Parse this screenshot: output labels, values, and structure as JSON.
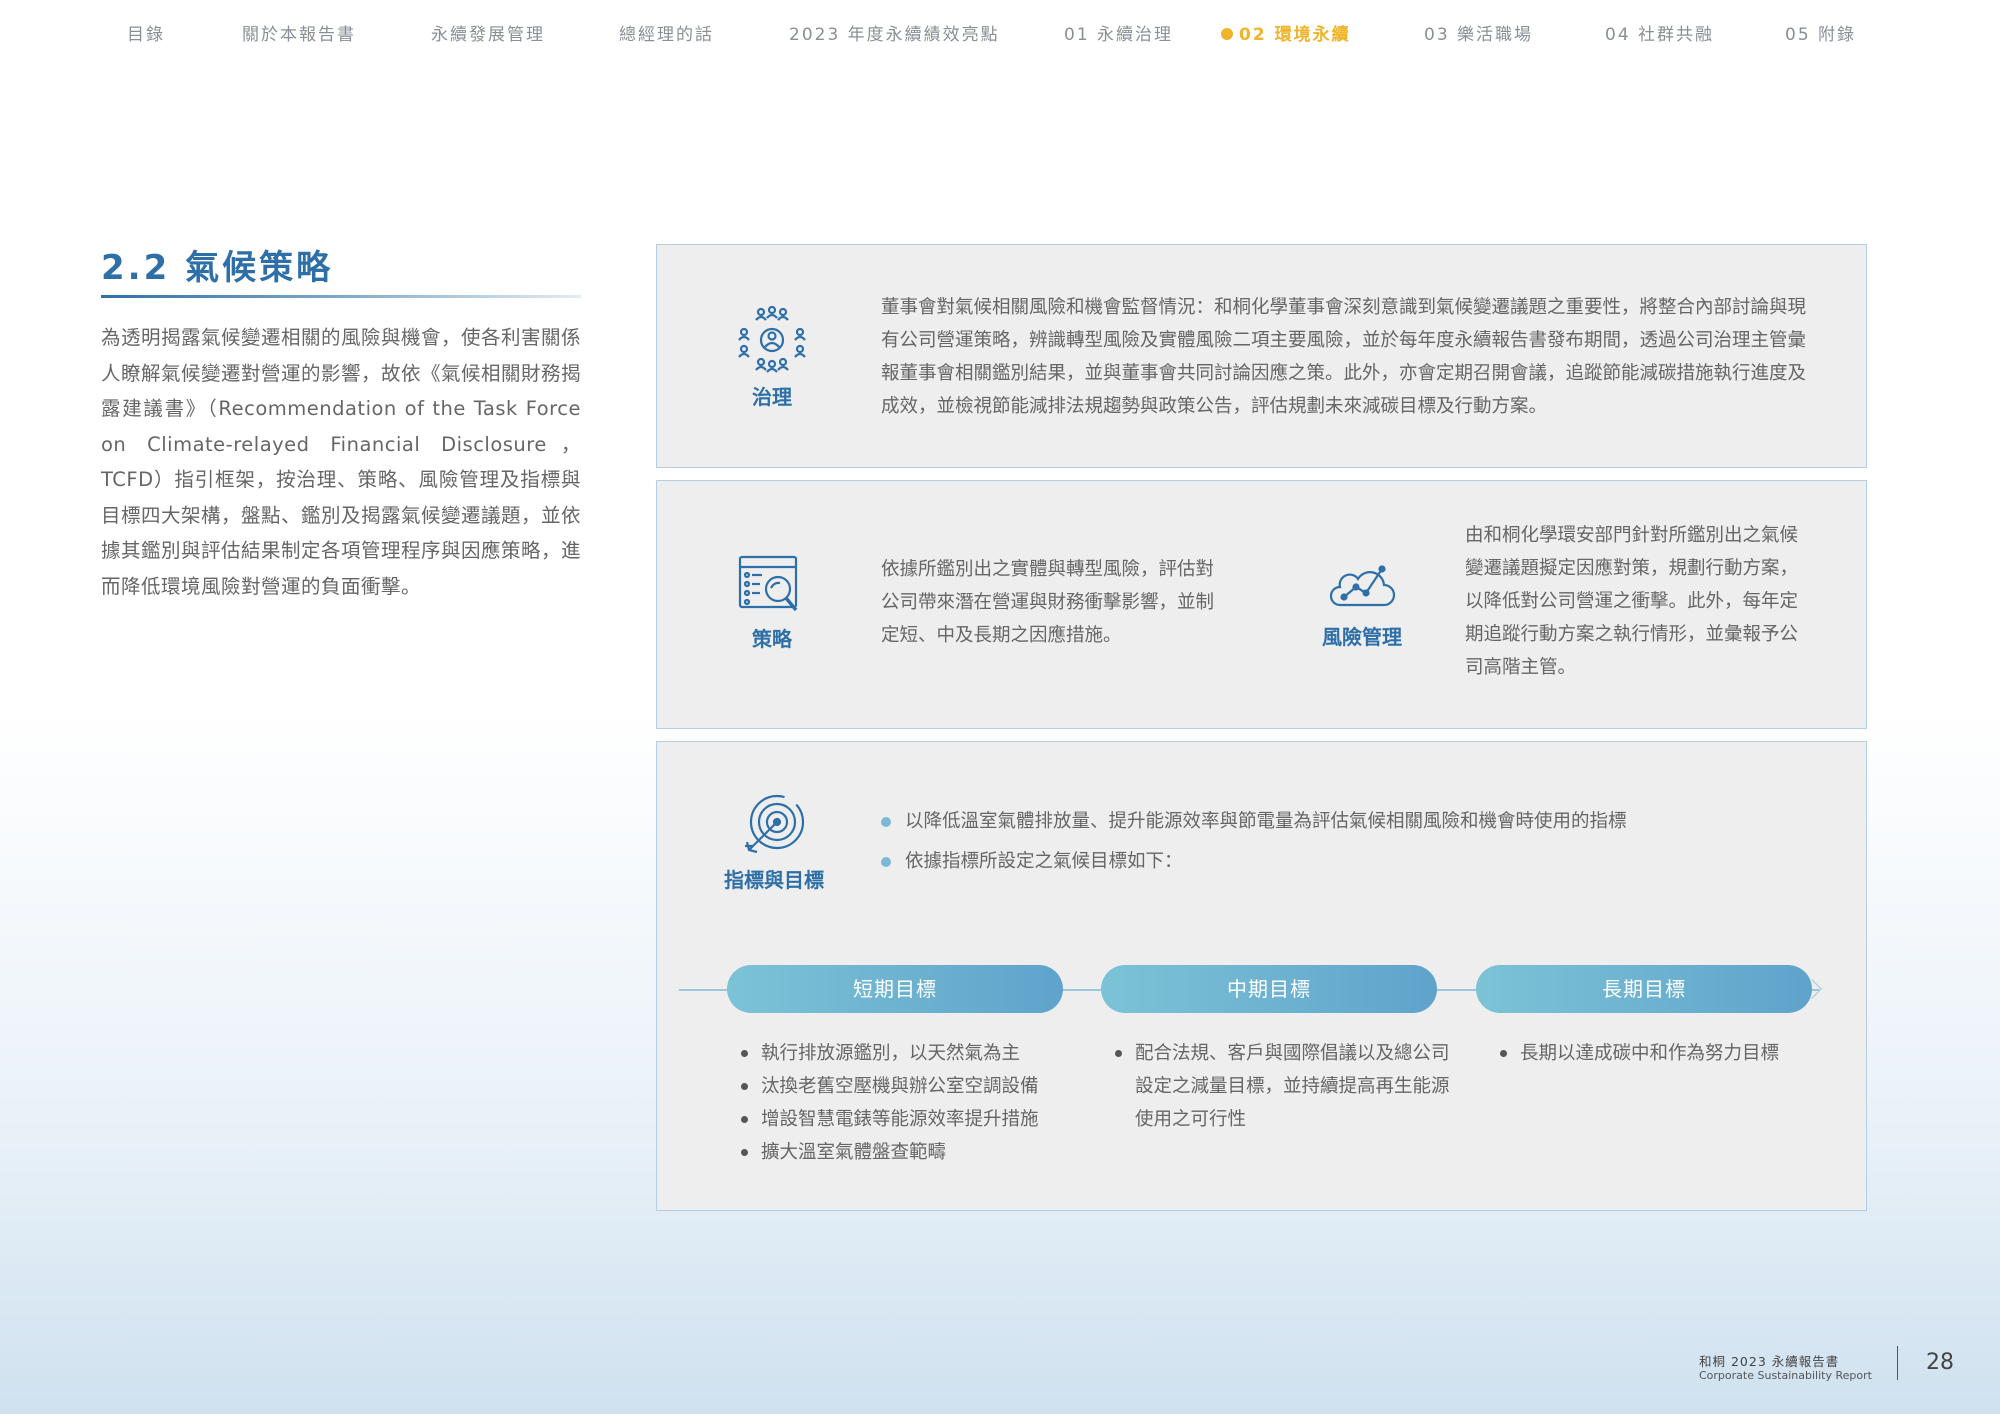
{
  "nav": {
    "items": [
      "目錄",
      "關於本報告書",
      "永續發展管理",
      "總經理的話",
      "2023 年度永續績效亮點",
      "01 永續治理",
      "02 環境永續",
      "03 樂活職場",
      "04 社群共融",
      "05 附錄"
    ],
    "active_index": 6
  },
  "section": {
    "title": "2.2 氣候策略",
    "intro": "為透明揭露氣候變遷相關的風險與機會，使各利害關係人瞭解氣候變遷對營運的影響，故依《氣候相關財務揭露建議書》（Recommendation of the Task Force on Climate-relayed Financial Disclosure，TCFD）指引框架，按治理、策略、風險管理及指標與目標四大架構，盤點、鑑別及揭露氣候變遷議題，並依據其鑑別與評估結果制定各項管理程序與因應策略，進而降低環境風險對營運的負面衝擊。"
  },
  "governance": {
    "label": "治理",
    "icon": "people-network-icon",
    "text": "董事會對氣候相關風險和機會監督情況：和桐化學董事會深刻意識到氣候變遷議題之重要性，將整合內部討論與現有公司營運策略，辨識轉型風險及實體風險二項主要風險，並於每年度永續報告書發布期間，透過公司治理主管彙報董事會相關鑑別結果，並與董事會共同討論因應之策。此外，亦會定期召開會議，追蹤節能減碳措施執行進度及成效，並檢視節能減排法規趨勢與政策公告，評估規劃未來減碳目標及行動方案。"
  },
  "strategy": {
    "label": "策略",
    "icon": "document-magnifier-icon",
    "text": "依據所鑑別出之實體與轉型風險，評估對公司帶來潛在營運與財務衝擊影響，並制定短、中及長期之因應措施。"
  },
  "risk": {
    "label": "風險管理",
    "icon": "cloud-chart-icon",
    "text": "由和桐化學環安部門針對所鑑別出之氣候變遷議題擬定因應對策，規劃行動方案，以降低對公司營運之衝擊。此外，每年定期追蹤行動方案之執行情形，並彙報予公司高階主管。"
  },
  "metrics": {
    "label": "指標與目標",
    "icon": "target-icon",
    "bullets": [
      "以降低溫室氣體排放量、提升能源效率與節電量為評估氣候相關風險和機會時使用的指標",
      "依據指標所設定之氣候目標如下："
    ],
    "goals": [
      {
        "title": "短期目標",
        "items": [
          "執行排放源鑑別，以天然氣為主",
          "汰換老舊空壓機與辦公室空調設備",
          "增設智慧電錶等能源效率提升措施",
          "擴大溫室氣體盤查範疇"
        ]
      },
      {
        "title": "中期目標",
        "items": [
          "配合法規、客戶與國際倡議以及總公司設定之減量目標，並持續提高再生能源使用之可行性"
        ]
      },
      {
        "title": "長期目標",
        "items": [
          "長期以達成碳中和作為努力目標"
        ]
      }
    ]
  },
  "footer": {
    "title": "和桐 2023 永續報告書",
    "subtitle": "Corporate Sustainability Report",
    "page": "28"
  },
  "colors": {
    "brand_blue": "#2e6fa8",
    "active_nav": "#f0b428",
    "pill": "#6aaecf"
  }
}
